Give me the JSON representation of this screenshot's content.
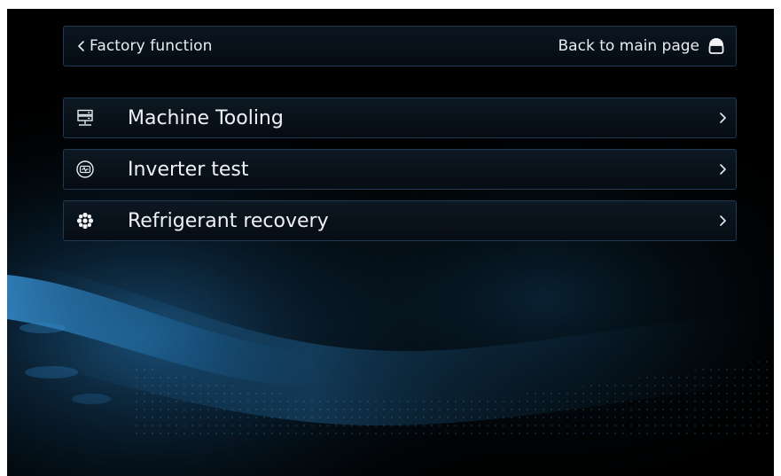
{
  "header": {
    "title": "Factory function",
    "home_label": "Back to main page",
    "back_icon": "chevron-left-icon",
    "home_icon": "home-icon"
  },
  "menu": {
    "items": [
      {
        "label": "Machine Tooling",
        "icon": "server-icon"
      },
      {
        "label": "Inverter test",
        "icon": "inverter-icon"
      },
      {
        "label": "Refrigerant recovery",
        "icon": "snowflake-icon"
      }
    ]
  },
  "colors": {
    "background": "#000000",
    "panel_border": "#1f3a52",
    "text": "#eef2f6",
    "accent_glow": "#1f6aa0"
  }
}
